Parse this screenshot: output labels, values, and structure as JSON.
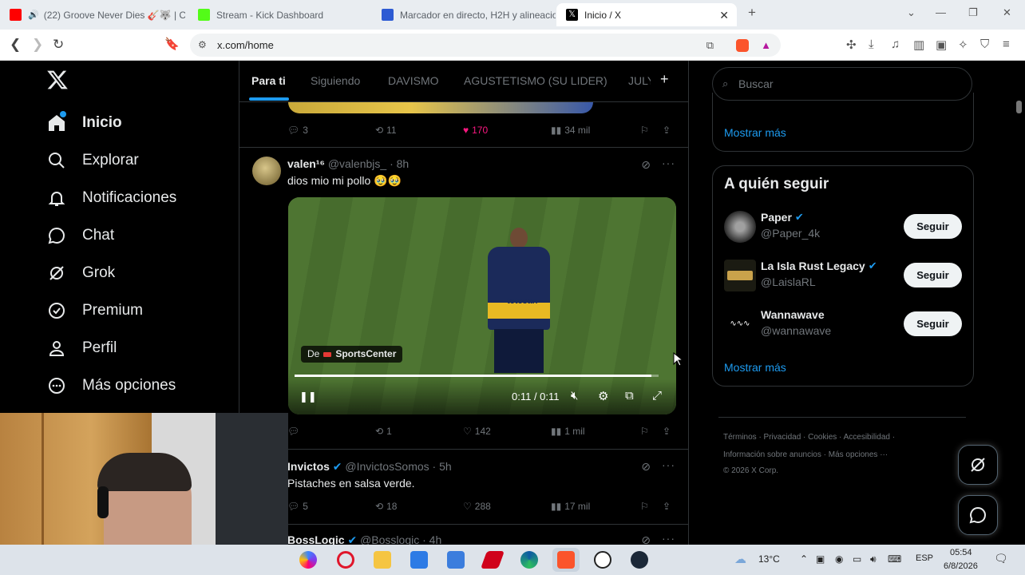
{
  "browser": {
    "tabs": [
      {
        "title": "(22) Groove Never Dies 🎸🐺 | C",
        "favicon_color": "#ff0000"
      },
      {
        "title": "Stream - Kick Dashboard",
        "favicon_color": "#53fc18"
      },
      {
        "title": "Marcador en directo, H2H y alineacio",
        "favicon_color": "#2d5bd3"
      },
      {
        "title": "Inicio / X",
        "favicon_color": "#000000",
        "active": true
      }
    ],
    "url": "x.com/home"
  },
  "sidebar": {
    "items": [
      {
        "label": "Inicio",
        "icon": "home-icon"
      },
      {
        "label": "Explorar",
        "icon": "search-icon"
      },
      {
        "label": "Notificaciones",
        "icon": "bell-icon"
      },
      {
        "label": "Chat",
        "icon": "chat-icon"
      },
      {
        "label": "Grok",
        "icon": "grok-icon"
      },
      {
        "label": "Premium",
        "icon": "verified-icon"
      },
      {
        "label": "Perfil",
        "icon": "person-icon"
      },
      {
        "label": "Más opciones",
        "icon": "more-circle-icon"
      }
    ]
  },
  "feed": {
    "tabs": [
      "Para ti",
      "Siguiendo",
      "DAVISMO",
      "AGUSTETISMO (SU LIDER)",
      "JULY"
    ],
    "post0": {
      "replies": "3",
      "reposts": "11",
      "likes": "170",
      "views": "34 mil"
    },
    "post1": {
      "name": "valen¹⁶",
      "handle": "@valenbjs_ · 8h",
      "text": "dios mio mi pollo 🥹🥹",
      "video": {
        "source_prefix": "De",
        "source": "SportsCenter",
        "sponsor": "tetesan",
        "time": "0:11 / 0:11",
        "progress": 0.98
      },
      "replies": "",
      "reposts": "1",
      "likes": "142",
      "views": "1 mil"
    },
    "post2": {
      "name": "Invictos",
      "handle": "@InvictosSomos · 5h",
      "text": "Pistaches en salsa verde.",
      "replies": "5",
      "reposts": "18",
      "likes": "288",
      "views": "17 mil"
    },
    "post3": {
      "name": "BossLogic",
      "handle": "@Bosslogic · 4h"
    }
  },
  "right": {
    "search_placeholder": "Buscar",
    "show_more": "Mostrar más",
    "who_to_follow_title": "A quién seguir",
    "follow_label": "Seguir",
    "suggestions": [
      {
        "name": "Paper",
        "handle": "@Paper_4k",
        "verified": true
      },
      {
        "name": "La Isla Rust Legacy",
        "handle": "@LaislaRL",
        "verified": true
      },
      {
        "name": "Wannawave",
        "handle": "@wannawave",
        "verified": false
      }
    ],
    "footer_line1": "Términos · Privacidad · Cookies · Accesibilidad ·",
    "footer_line2": "Información sobre anuncios · Más opciones ···",
    "footer_line3": "© 2026 X Corp."
  },
  "taskbar": {
    "weather": "13°C",
    "lang": "ESP",
    "time": "05:54",
    "date": "6/8/2026"
  },
  "colors": {
    "accent": "#1d9bf0",
    "like": "#f91880",
    "bg": "#000000"
  }
}
